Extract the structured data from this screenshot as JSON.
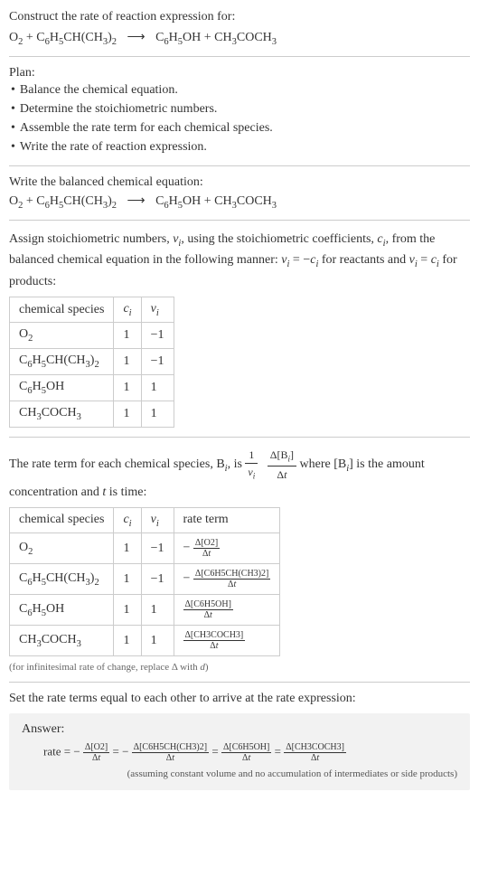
{
  "prompt": {
    "line1": "Construct the rate of reaction expression for:",
    "reactant1": "O",
    "reactant1_sub": "2",
    "plus1": " + ",
    "reactant2_a": "C",
    "reactant2_b": "H",
    "reactant2_c": "CH(CH",
    "reactant2_d": ")",
    "product1_a": "C",
    "product1_b": "H",
    "product1_c": "OH",
    "plus2": " + ",
    "product2_a": "CH",
    "product2_b": "COCH",
    "arrow": "⟶"
  },
  "plan": {
    "title": "Plan:",
    "items": [
      "Balance the chemical equation.",
      "Determine the stoichiometric numbers.",
      "Assemble the rate term for each chemical species.",
      "Write the rate of reaction expression."
    ]
  },
  "balanced": {
    "title": "Write the balanced chemical equation:"
  },
  "stoich": {
    "intro1": "Assign stoichiometric numbers, ",
    "nu": "ν",
    "sub_i": "i",
    "intro2": ", using the stoichiometric coefficients, ",
    "c": "c",
    "intro3": ", from the balanced chemical equation in the following manner: ",
    "eq1a": " = −",
    "eq1b": " for reactants and ",
    "eq2a": " = ",
    "eq2b": " for products:",
    "headers": [
      "chemical species",
      "c",
      "ν"
    ],
    "rows": [
      {
        "species": "O2",
        "c": "1",
        "nu": "−1"
      },
      {
        "species": "C6H5CH(CH3)2",
        "c": "1",
        "nu": "−1"
      },
      {
        "species": "C6H5OH",
        "c": "1",
        "nu": "1"
      },
      {
        "species": "CH3COCH3",
        "c": "1",
        "nu": "1"
      }
    ]
  },
  "rateterm": {
    "intro1": "The rate term for each chemical species, B",
    "intro2": ", is ",
    "intro3": " where [B",
    "intro4": "] is the amount concentration and ",
    "t": "t",
    "intro5": " is time:",
    "one": "1",
    "delta": "Δ[B",
    "deltab": "]",
    "dt": "Δt",
    "headers": [
      "chemical species",
      "c",
      "ν",
      "rate term"
    ],
    "rows": [
      {
        "species": "O2",
        "c": "1",
        "nu": "−1",
        "sign": "−",
        "conc": "Δ[O2]"
      },
      {
        "species": "C6H5CH(CH3)2",
        "c": "1",
        "nu": "−1",
        "sign": "−",
        "conc": "Δ[C6H5CH(CH3)2]"
      },
      {
        "species": "C6H5OH",
        "c": "1",
        "nu": "1",
        "sign": "",
        "conc": "Δ[C6H5OH]"
      },
      {
        "species": "CH3COCH3",
        "c": "1",
        "nu": "1",
        "sign": "",
        "conc": "Δ[CH3COCH3]"
      }
    ],
    "note": "(for infinitesimal rate of change, replace Δ with d)"
  },
  "final": {
    "title": "Set the rate terms equal to each other to arrive at the rate expression:"
  },
  "answer": {
    "label": "Answer:",
    "rate": "rate = ",
    "neg": "−",
    "eq": " = ",
    "terms": [
      {
        "sign": "−",
        "conc": "Δ[O2]"
      },
      {
        "sign": "−",
        "conc": "Δ[C6H5CH(CH3)2]"
      },
      {
        "sign": "",
        "conc": "Δ[C6H5OH]"
      },
      {
        "sign": "",
        "conc": "Δ[CH3COCH3]"
      }
    ],
    "dt": "Δt",
    "note": "(assuming constant volume and no accumulation of intermediates or side products)"
  },
  "chem": {
    "O2": {
      "parts": [
        "O",
        "2"
      ]
    },
    "cumene": {
      "parts": [
        "C",
        "6",
        "H",
        "5",
        "CH(CH",
        "3",
        ")",
        "2"
      ]
    },
    "phenol": {
      "parts": [
        "C",
        "6",
        "H",
        "5",
        "OH"
      ]
    },
    "acetone": {
      "parts": [
        "CH",
        "3",
        "COCH",
        "3"
      ]
    }
  }
}
